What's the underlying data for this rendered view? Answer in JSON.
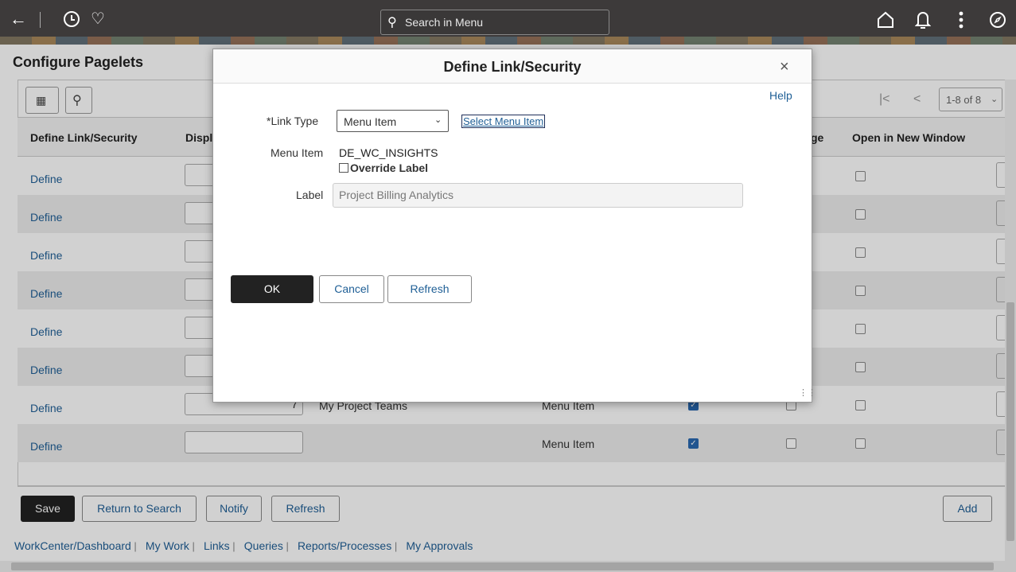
{
  "header": {
    "search_placeholder": "Search in Menu"
  },
  "page": {
    "title": "Configure Pagelets",
    "pager": "1-8 of 8",
    "columns": {
      "define": "Define Link/Security",
      "display": "Displ",
      "image": "ge",
      "new_window": "Open in New Window"
    },
    "define_label": "Define",
    "rows": [
      {
        "seq": "",
        "label": "",
        "type": ""
      },
      {
        "seq": "",
        "label": "",
        "type": ""
      },
      {
        "seq": "",
        "label": "",
        "type": ""
      },
      {
        "seq": "",
        "label": "",
        "type": ""
      },
      {
        "seq": "",
        "label": "",
        "type": ""
      },
      {
        "seq": "",
        "label": "",
        "type": ""
      },
      {
        "seq": "7",
        "label": "My Project Teams",
        "type": "Menu Item"
      },
      {
        "seq": "",
        "label": "",
        "type": "Menu Item"
      }
    ]
  },
  "buttons": {
    "save": "Save",
    "return_to_search": "Return to Search",
    "notify": "Notify",
    "refresh": "Refresh",
    "add": "Add"
  },
  "footer_links": [
    "WorkCenter/Dashboard",
    "My Work",
    "Links",
    "Queries",
    "Reports/Processes",
    "My Approvals"
  ],
  "modal": {
    "title": "Define Link/Security",
    "close": "×",
    "help": "Help",
    "link_type_label": "*Link Type",
    "link_type_value": "Menu Item",
    "select_menu_item": "Select Menu Item",
    "menu_item_label": "Menu Item",
    "menu_item_value": "DE_WC_INSIGHTS",
    "override_label": "Override Label",
    "label_label": "Label",
    "label_value": "Project Billing Analytics",
    "ok": "OK",
    "cancel": "Cancel",
    "refresh": "Refresh"
  }
}
